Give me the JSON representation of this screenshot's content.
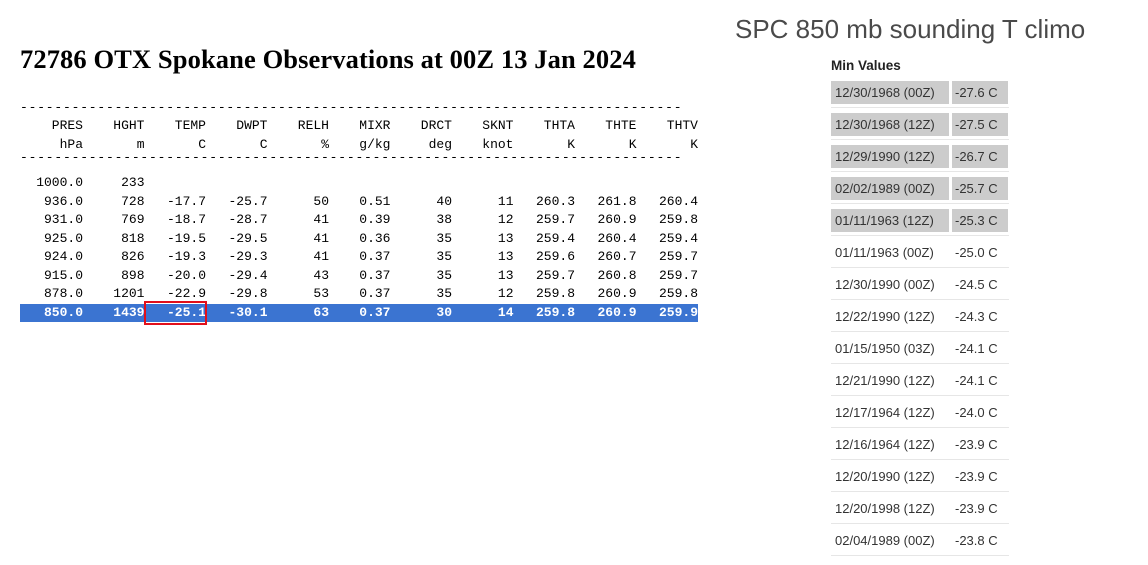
{
  "title": "72786 OTX Spokane Observations at 00Z 13 Jan 2024",
  "climo_title": "SPC 850 mb sounding T climo",
  "sounding": {
    "dashes": "-----------------------------------------------------------------------------",
    "columns": [
      {
        "name": "PRES",
        "unit": "hPa"
      },
      {
        "name": "HGHT",
        "unit": "m"
      },
      {
        "name": "TEMP",
        "unit": "C"
      },
      {
        "name": "DWPT",
        "unit": "C"
      },
      {
        "name": "RELH",
        "unit": "%"
      },
      {
        "name": "MIXR",
        "unit": "g/kg"
      },
      {
        "name": "DRCT",
        "unit": "deg"
      },
      {
        "name": "SKNT",
        "unit": "knot"
      },
      {
        "name": "THTA",
        "unit": "K"
      },
      {
        "name": "THTE",
        "unit": "K"
      },
      {
        "name": "THTV",
        "unit": "K"
      }
    ],
    "rows": [
      [
        "1000.0",
        "233",
        "",
        "",
        "",
        "",
        "",
        "",
        "",
        "",
        ""
      ],
      [
        "936.0",
        "728",
        "-17.7",
        "-25.7",
        "50",
        "0.51",
        "40",
        "11",
        "260.3",
        "261.8",
        "260.4"
      ],
      [
        "931.0",
        "769",
        "-18.7",
        "-28.7",
        "41",
        "0.39",
        "38",
        "12",
        "259.7",
        "260.9",
        "259.8"
      ],
      [
        "925.0",
        "818",
        "-19.5",
        "-29.5",
        "41",
        "0.36",
        "35",
        "13",
        "259.4",
        "260.4",
        "259.4"
      ],
      [
        "924.0",
        "826",
        "-19.3",
        "-29.3",
        "41",
        "0.37",
        "35",
        "13",
        "259.6",
        "260.7",
        "259.7"
      ],
      [
        "915.0",
        "898",
        "-20.0",
        "-29.4",
        "43",
        "0.37",
        "35",
        "13",
        "259.7",
        "260.8",
        "259.7"
      ],
      [
        "878.0",
        "1201",
        "-22.9",
        "-29.8",
        "53",
        "0.37",
        "35",
        "12",
        "259.8",
        "260.9",
        "259.8"
      ],
      [
        "850.0",
        "1439",
        "-25.1",
        "-30.1",
        "63",
        "0.37",
        "30",
        "14",
        "259.8",
        "260.9",
        "259.9"
      ]
    ]
  },
  "min_values": {
    "heading": "Min Values",
    "rows": [
      {
        "date": "12/30/1968 (00Z)",
        "value": "-27.6 C"
      },
      {
        "date": "12/30/1968 (12Z)",
        "value": "-27.5 C"
      },
      {
        "date": "12/29/1990 (12Z)",
        "value": "-26.7 C"
      },
      {
        "date": "02/02/1989 (00Z)",
        "value": "-25.7 C"
      },
      {
        "date": "01/11/1963 (12Z)",
        "value": "-25.3 C"
      },
      {
        "date": "01/11/1963 (00Z)",
        "value": "-25.0 C"
      },
      {
        "date": "12/30/1990 (00Z)",
        "value": "-24.5 C"
      },
      {
        "date": "12/22/1990 (12Z)",
        "value": "-24.3 C"
      },
      {
        "date": "01/15/1950 (03Z)",
        "value": "-24.1 C"
      },
      {
        "date": "12/21/1990 (12Z)",
        "value": "-24.1 C"
      },
      {
        "date": "12/17/1964 (12Z)",
        "value": "-24.0 C"
      },
      {
        "date": "12/16/1964 (12Z)",
        "value": "-23.9 C"
      },
      {
        "date": "12/20/1990 (12Z)",
        "value": "-23.9 C"
      },
      {
        "date": "12/20/1998 (12Z)",
        "value": "-23.9 C"
      },
      {
        "date": "02/04/1989 (00Z)",
        "value": "-23.8 C"
      }
    ]
  }
}
